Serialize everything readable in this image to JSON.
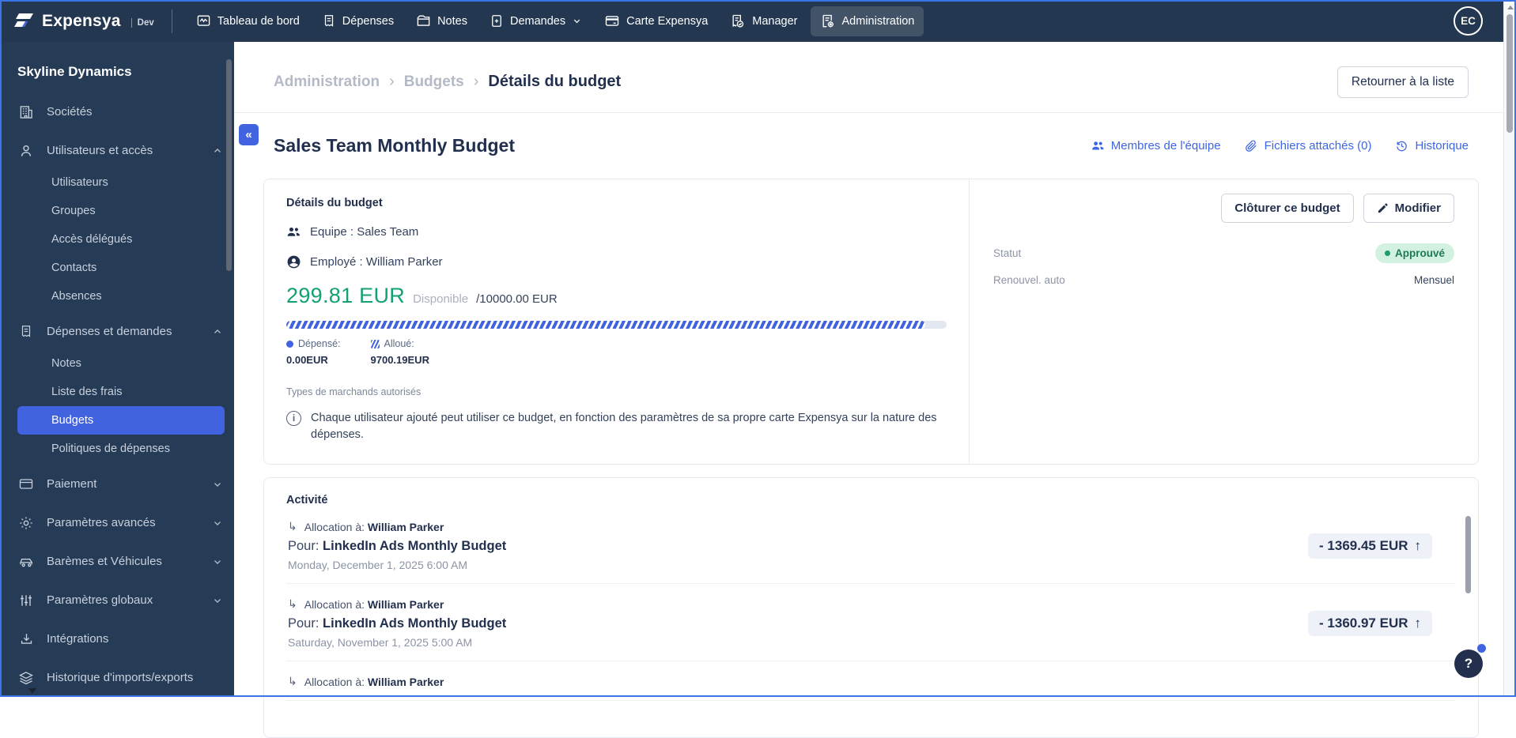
{
  "colors": {
    "accent_blue": "#4163e0",
    "navy": "#233750",
    "green": "#13a171",
    "approved_bg": "#d3f1e1",
    "approved_text": "#1d7a55"
  },
  "navbar": {
    "logo": "Expensya",
    "env": "Dev",
    "items": [
      {
        "label": "Tableau de bord"
      },
      {
        "label": "Dépenses"
      },
      {
        "label": "Notes"
      },
      {
        "label": "Demandes"
      },
      {
        "label": "Carte Expensya"
      },
      {
        "label": "Manager"
      },
      {
        "label": "Administration"
      }
    ],
    "avatar": "EC"
  },
  "sidebar": {
    "company": "Skyline Dynamics",
    "items": [
      {
        "label": "Sociétés"
      },
      {
        "label": "Utilisateurs et accès"
      },
      {
        "label": "Utilisateurs"
      },
      {
        "label": "Groupes"
      },
      {
        "label": "Accès délégués"
      },
      {
        "label": "Contacts"
      },
      {
        "label": "Absences"
      },
      {
        "label": "Dépenses et demandes"
      },
      {
        "label": "Notes"
      },
      {
        "label": "Liste des frais"
      },
      {
        "label": "Budgets"
      },
      {
        "label": "Politiques de dépenses"
      },
      {
        "label": "Paiement"
      },
      {
        "label": "Paramètres avancés"
      },
      {
        "label": "Barèmes et Véhicules"
      },
      {
        "label": "Paramètres globaux"
      },
      {
        "label": "Intégrations"
      },
      {
        "label": "Historique d'imports/exports"
      }
    ]
  },
  "header": {
    "breadcrumb": [
      "Administration",
      "Budgets",
      "Détails du budget"
    ],
    "separator": "›",
    "back_button": "Retourner à la liste",
    "collapse_glyph": "«"
  },
  "page": {
    "title": "Sales Team Monthly Budget",
    "links": [
      {
        "label": "Membres de l'équipe"
      },
      {
        "label": "Fichiers attachés (0)"
      },
      {
        "label": "Historique"
      }
    ]
  },
  "details_card": {
    "title": "Détails du budget",
    "team": "Equipe : Sales Team",
    "employee": "Employé : William Parker",
    "available_amount": "299.81 EUR",
    "available_label": "Disponible",
    "total_amount": "/10000.00 EUR",
    "progress_width": "96.8%",
    "legend_spent_label": "Dépensé:",
    "legend_spent_value": "0.00EUR",
    "legend_allocated_label": "Alloué:",
    "legend_allocated_value": "9700.19EUR",
    "merchants_label": "Types de marchands autorisés",
    "info_text": "Chaque utilisateur ajouté peut utiliser ce budget, en fonction des paramètres de sa propre carte Expensya sur la nature des dépenses.",
    "close_button": "Clôturer ce budget",
    "edit_button": "Modifier",
    "status_label": "Statut",
    "status_value": "Approuvé",
    "renewal_label": "Renouvel. auto",
    "renewal_value": "Mensuel"
  },
  "activity": {
    "title": "Activité",
    "rows": [
      {
        "allocation_label": "Allocation à:",
        "allocation_name": "William Parker",
        "target_label": "Pour:",
        "target_name": "LinkedIn Ads Monthly Budget",
        "date": "Monday, December 1, 2025 6:00 AM",
        "amount": "- 1369.45 EUR",
        "arrow": "↑"
      },
      {
        "allocation_label": "Allocation à:",
        "allocation_name": "William Parker",
        "target_label": "Pour:",
        "target_name": "LinkedIn Ads Monthly Budget",
        "date": "Saturday, November 1, 2025 5:00 AM",
        "amount": "- 1360.97 EUR",
        "arrow": "↑"
      },
      {
        "allocation_label": "Allocation à:",
        "allocation_name": "William Parker"
      }
    ]
  },
  "help": {
    "label": "?"
  }
}
